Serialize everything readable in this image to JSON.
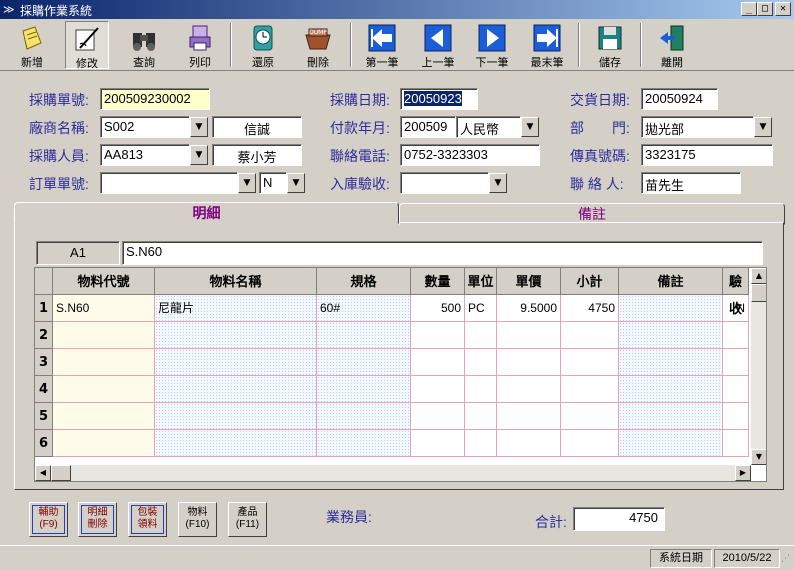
{
  "window": {
    "title": "採購作業系統"
  },
  "toolbar": [
    {
      "label": "新增",
      "icon": "new-document-icon"
    },
    {
      "label": "修改",
      "icon": "edit-pen-icon"
    },
    {
      "label": "查詢",
      "icon": "binoculars-icon"
    },
    {
      "label": "列印",
      "icon": "print-icon"
    },
    {
      "label": "還原",
      "icon": "clock-icon"
    },
    {
      "label": "刪除",
      "icon": "dump-icon"
    },
    {
      "label": "第一筆",
      "icon": "first-arrow-icon"
    },
    {
      "label": "上一筆",
      "icon": "prev-arrow-icon"
    },
    {
      "label": "下一筆",
      "icon": "next-arrow-icon"
    },
    {
      "label": "最末筆",
      "icon": "last-arrow-icon"
    },
    {
      "label": "儲存",
      "icon": "floppy-icon"
    },
    {
      "label": "離開",
      "icon": "exit-door-icon"
    }
  ],
  "form": {
    "order_no_label": "採購單號:",
    "order_no": "200509230002",
    "vendor_label": "廠商名稱:",
    "vendor_code": "S002",
    "vendor_name": "信誠",
    "buyer_label": "採購人員:",
    "buyer_code": "AA813",
    "buyer_name": "蔡小芳",
    "po_label": "訂單單號:",
    "po_value": "",
    "po_flag": "N",
    "order_date_label": "採購日期:",
    "order_date": "20050923",
    "pay_month_label": "付款年月:",
    "pay_month": "200509",
    "currency": "人民幣",
    "phone_label": "聯絡電話:",
    "phone": "0752-3323303",
    "inspect_label": "入庫驗收:",
    "inspect_value": "",
    "delivery_date_label": "交貨日期:",
    "delivery_date": "20050924",
    "dept_label": "部　　門:",
    "dept": "拋光部",
    "fax_label": "傳真號碼:",
    "fax": "3323175",
    "contact_label": "聯 絡 人:",
    "contact": "苗先生"
  },
  "tabs": [
    {
      "label": "明細",
      "active": true,
      "color": "#800080"
    },
    {
      "label": "備註",
      "active": false,
      "color": "#800080"
    }
  ],
  "cellref": {
    "cell": "A1",
    "value": "S.N60"
  },
  "grid": {
    "columns": [
      "物料代號",
      "物料名稱",
      "規格",
      "數量",
      "單位",
      "單價",
      "小計",
      "備註",
      "驗收"
    ],
    "row_numbers": [
      "1",
      "2",
      "3",
      "4",
      "5",
      "6"
    ],
    "rows": [
      [
        "S.N60",
        "尼龍片",
        "60#",
        "500",
        "PC",
        "9.5000",
        "4750",
        "",
        "N"
      ],
      [
        "",
        "",
        "",
        "",
        "",
        "",
        "",
        "",
        ""
      ],
      [
        "",
        "",
        "",
        "",
        "",
        "",
        "",
        "",
        ""
      ],
      [
        "",
        "",
        "",
        "",
        "",
        "",
        "",
        "",
        ""
      ],
      [
        "",
        "",
        "",
        "",
        "",
        "",
        "",
        "",
        ""
      ],
      [
        "",
        "",
        "",
        "",
        "",
        "",
        "",
        "",
        ""
      ]
    ]
  },
  "bottom_buttons": [
    {
      "line1": "輔助",
      "line2": "(F9)"
    },
    {
      "line1": "明細",
      "line2": "刪除"
    },
    {
      "line1": "包裝",
      "line2": "領料"
    },
    {
      "line1": "物料",
      "line2": "(F10)"
    },
    {
      "line1": "產品",
      "line2": "(F11)"
    }
  ],
  "salesman_label": "業務員:",
  "total_label": "合計:",
  "total": "4750",
  "status": {
    "label": "系統日期",
    "date": "2010/5/22"
  }
}
